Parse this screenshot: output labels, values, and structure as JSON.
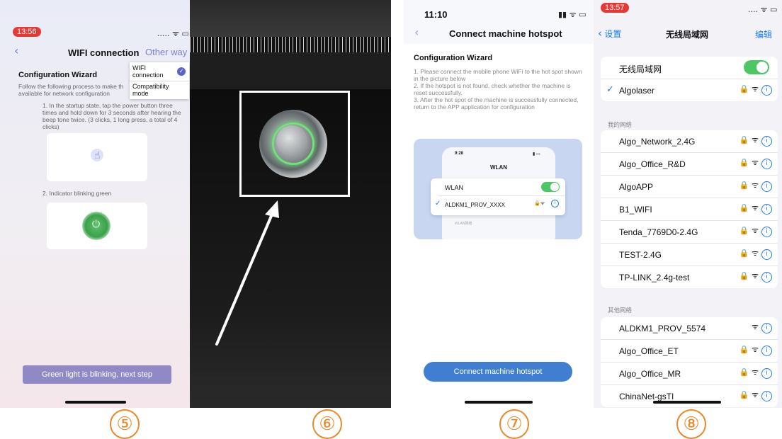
{
  "panel1": {
    "time": "13:56",
    "status": "..... ᯤ ▭",
    "back": "‹",
    "title": "WIFI connection",
    "other": "Other way",
    "menu": {
      "item1": "WIFI connection",
      "item2": "Compatibility mode"
    },
    "wizard_title": "Configuration Wizard",
    "intro": "Follow the following process to make th",
    "intro2": "available for network configuration",
    "step1": "1. In the startup state, tap the power button three times and hold down for 3 seconds after hearing the beep tone twice. (3 clicks, 1 long press, a total of 4 clicks)",
    "step2": "2. Indicator blinking green",
    "button": "Green light is blinking, next step",
    "badge": "⑤"
  },
  "panel2": {
    "badge": "⑥"
  },
  "panel3": {
    "time": "11:10",
    "back": "‹",
    "title": "Connect machine hotspot",
    "wizard_title": "Configuration Wizard",
    "steps": "1. Please connect the mobile phone WiFi to the hot spot shown in the picture below\n2. If the hotspot is not found, check whether the machine is reset successfully.\n3. After the hot spot of the machine is successfully connected, return to the APP application for configuration",
    "mock_time": "9:28",
    "mock_title": "WLAN",
    "mock_wlan": "WLAN",
    "mock_net": "ALDKM1_PROV_XXXX",
    "mock_section": "WLAN网络",
    "button": "Connect machine hotspot",
    "badge": "⑦"
  },
  "panel4": {
    "time": "13:57",
    "back": "设置",
    "title": "无线局域网",
    "edit": "编辑",
    "wlan_label": "无线局域网",
    "connected": "Algolaser",
    "my_networks_label": "我的网络",
    "my_networks": [
      "Algo_Network_2.4G",
      "Algo_Office_R&D",
      "AlgoAPP",
      "B1_WIFI",
      "Tenda_7769D0-2.4G",
      "TEST-2.4G",
      "TP-LINK_2.4g-test"
    ],
    "other_networks_label": "其他网络",
    "other_networks": [
      "ALDKM1_PROV_5574",
      "Algo_Office_ET",
      "Algo_Office_MR",
      "ChinaNet-gsTI"
    ],
    "badge": "⑧"
  }
}
